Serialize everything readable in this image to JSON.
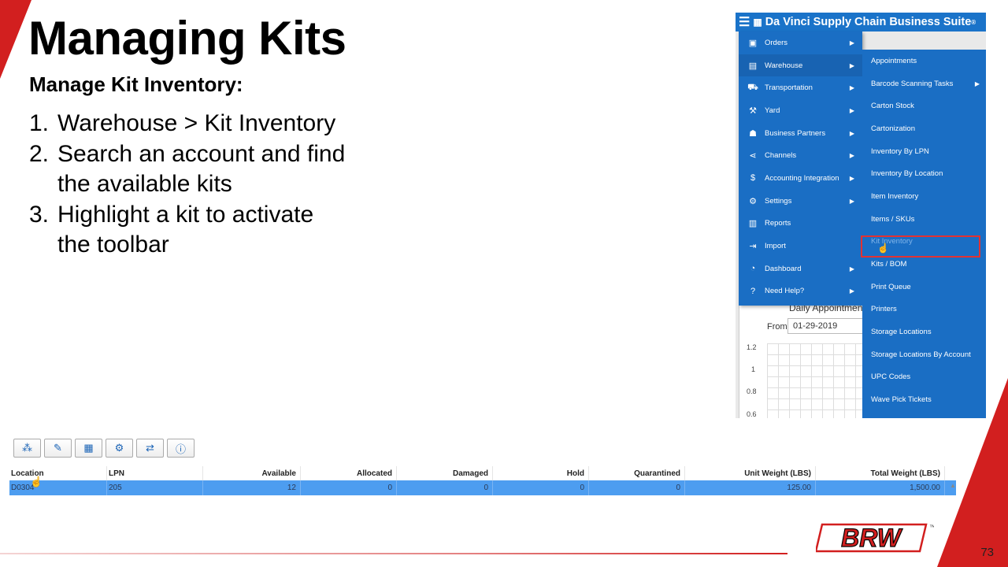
{
  "slide": {
    "title": "Managing Kits",
    "subtitle": "Manage Kit Inventory:",
    "steps": [
      {
        "num": "1.",
        "text": "Warehouse > Kit Inventory"
      },
      {
        "num": "2.",
        "text": "Search an account and find the available kits"
      },
      {
        "num": "3.",
        "text": "Highlight a kit to activate the toolbar"
      }
    ],
    "page_number": "73",
    "logo_text": "BRW",
    "logo_tm": "™",
    "accent_color": "#d21f1f"
  },
  "app": {
    "title": "Da Vinci Supply Chain Business Suite",
    "title_mark": "®",
    "menu": [
      {
        "label": "Orders",
        "icon": "box-icon",
        "glyph": "▣",
        "has_arrow": true
      },
      {
        "label": "Warehouse",
        "icon": "warehouse-icon",
        "glyph": "▤",
        "has_arrow": true,
        "active": true
      },
      {
        "label": "Transportation",
        "icon": "truck-icon",
        "glyph": "⛟",
        "has_arrow": true
      },
      {
        "label": "Yard",
        "icon": "dolly-icon",
        "glyph": "⚒",
        "has_arrow": true
      },
      {
        "label": "Business Partners",
        "icon": "users-icon",
        "glyph": "☗",
        "has_arrow": true
      },
      {
        "label": "Channels",
        "icon": "share-icon",
        "glyph": "⋖",
        "has_arrow": true
      },
      {
        "label": "Accounting Integration",
        "icon": "dollar-icon",
        "glyph": "$",
        "has_arrow": true
      },
      {
        "label": "Settings",
        "icon": "gear-icon",
        "glyph": "⚙",
        "has_arrow": true
      },
      {
        "label": "Reports",
        "icon": "bar-chart-icon",
        "glyph": "▥",
        "has_arrow": false
      },
      {
        "label": "Import",
        "icon": "import-icon",
        "glyph": "⇥",
        "has_arrow": false
      },
      {
        "label": "Dashboard",
        "icon": "dashboard-icon",
        "glyph": "◔",
        "has_arrow": true
      },
      {
        "label": "Need Help?",
        "icon": "question-icon",
        "glyph": "?",
        "has_arrow": true
      }
    ],
    "submenu": [
      {
        "label": "Appointments",
        "has_arrow": false
      },
      {
        "label": "Barcode Scanning Tasks",
        "has_arrow": true
      },
      {
        "label": "Carton Stock",
        "has_arrow": false
      },
      {
        "label": "Cartonization",
        "has_arrow": false
      },
      {
        "label": "Inventory By LPN",
        "has_arrow": false
      },
      {
        "label": "Inventory By Location",
        "has_arrow": false
      },
      {
        "label": "Item Inventory",
        "has_arrow": false
      },
      {
        "label": "Items / SKUs",
        "has_arrow": false
      },
      {
        "label": "Kit Inventory",
        "has_arrow": false,
        "highlighted": true
      },
      {
        "label": "Kits / BOM",
        "has_arrow": false
      },
      {
        "label": "Print Queue",
        "has_arrow": false
      },
      {
        "label": "Printers",
        "has_arrow": false
      },
      {
        "label": "Storage Locations",
        "has_arrow": false
      },
      {
        "label": "Storage Locations By Account",
        "has_arrow": false
      },
      {
        "label": "UPC Codes",
        "has_arrow": false
      },
      {
        "label": "Wave Pick Tickets",
        "has_arrow": false
      }
    ],
    "background": {
      "panel_title": "Daily Appointments",
      "from_label": "From",
      "from_date": "01-29-2019",
      "ticks": [
        "1.2",
        "1",
        "0.8",
        "0.6"
      ]
    },
    "brand_color": "#1a6ec4"
  },
  "toolbar": {
    "buttons": [
      {
        "icon": "kit-components-icon",
        "glyph": "⁂"
      },
      {
        "icon": "magic-wand-icon",
        "glyph": "✎"
      },
      {
        "icon": "pallet-icon",
        "glyph": "▦"
      },
      {
        "icon": "hand-truck-icon",
        "glyph": "⚙"
      },
      {
        "icon": "transfer-icon",
        "glyph": "⇄"
      },
      {
        "icon": "info-icon",
        "glyph": "ⓘ"
      }
    ]
  },
  "grid": {
    "headers": [
      "Location",
      "LPN",
      "Available",
      "Allocated",
      "Damaged",
      "Hold",
      "Quarantined",
      "Unit Weight (LBS)",
      "Total Weight (LBS)"
    ],
    "rows": [
      [
        "D0304",
        "205",
        "12",
        "0",
        "0",
        "0",
        "0",
        "125.00",
        "1,500.00"
      ]
    ],
    "selected_row_color": "#4d9df0"
  }
}
